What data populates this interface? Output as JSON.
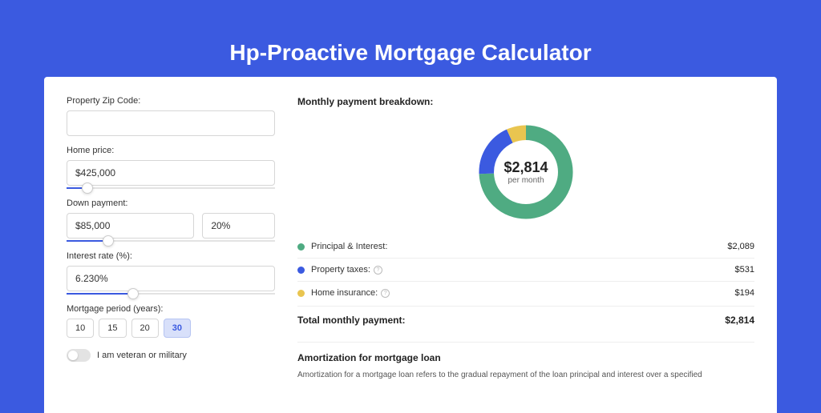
{
  "title": "Hp-Proactive Mortgage Calculator",
  "form": {
    "zip_label": "Property Zip Code:",
    "zip_value": "",
    "home_price_label": "Home price:",
    "home_price_value": "$425,000",
    "home_price_slider_pct": 10,
    "down_payment_label": "Down payment:",
    "down_payment_value": "$85,000",
    "down_payment_pct": "20%",
    "down_payment_slider_pct": 20,
    "rate_label": "Interest rate (%):",
    "rate_value": "6.230%",
    "rate_slider_pct": 32,
    "period_label": "Mortgage period (years):",
    "periods": [
      "10",
      "15",
      "20",
      "30"
    ],
    "period_active": "30",
    "veteran_label": "I am veteran or military"
  },
  "breakdown": {
    "title": "Monthly payment breakdown:",
    "center_amount": "$2,814",
    "center_sub": "per month",
    "items": [
      {
        "label": "Principal & Interest:",
        "value": "$2,089",
        "color": "#4fab82",
        "info": false
      },
      {
        "label": "Property taxes:",
        "value": "$531",
        "color": "#3b5ae0",
        "info": true
      },
      {
        "label": "Home insurance:",
        "value": "$194",
        "color": "#e9c550",
        "info": true
      }
    ],
    "total_label": "Total monthly payment:",
    "total_value": "$2,814"
  },
  "amortization": {
    "title": "Amortization for mortgage loan",
    "text": "Amortization for a mortgage loan refers to the gradual repayment of the loan principal and interest over a specified"
  },
  "chart_data": {
    "type": "pie",
    "title": "Monthly payment breakdown",
    "series": [
      {
        "name": "Principal & Interest",
        "value": 2089,
        "color": "#4fab82"
      },
      {
        "name": "Property taxes",
        "value": 531,
        "color": "#3b5ae0"
      },
      {
        "name": "Home insurance",
        "value": 194,
        "color": "#e9c550"
      }
    ],
    "total": 2814
  }
}
